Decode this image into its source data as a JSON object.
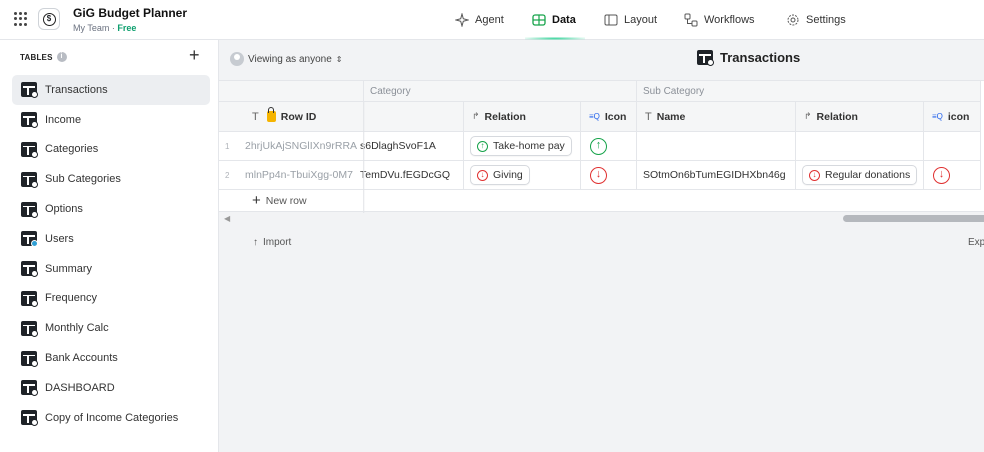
{
  "app": {
    "title": "GiG Budget Planner",
    "team": "My Team",
    "separator": " · ",
    "plan": "Free"
  },
  "nav": [
    {
      "label": "Agent",
      "icon": "sparkle-icon"
    },
    {
      "label": "Data",
      "icon": "table-icon",
      "active": true
    },
    {
      "label": "Layout",
      "icon": "layout-icon"
    },
    {
      "label": "Workflows",
      "icon": "workflow-icon"
    },
    {
      "label": "Settings",
      "icon": "gear-icon"
    }
  ],
  "sidebar": {
    "heading": "TABLES",
    "info": "i",
    "add": "+",
    "items": [
      {
        "label": "Transactions",
        "selected": true
      },
      {
        "label": "Income"
      },
      {
        "label": "Categories"
      },
      {
        "label": "Sub Categories"
      },
      {
        "label": "Options"
      },
      {
        "label": "Users"
      },
      {
        "label": "Summary"
      },
      {
        "label": "Frequency"
      },
      {
        "label": "Monthly Calc"
      },
      {
        "label": "Bank Accounts"
      },
      {
        "label": "DASHBOARD"
      },
      {
        "label": "Copy of Income Categories"
      }
    ]
  },
  "toolbar": {
    "viewing": "Viewing as anyone",
    "table_title": "Transactions"
  },
  "grid": {
    "groups": {
      "category": "Category",
      "sub_category": "Sub Category"
    },
    "headers": {
      "row_id": "Row ID",
      "relation1": "Relation",
      "icon1": "Icon",
      "name": "Name",
      "relation2": "Relation",
      "icon2": "icon"
    },
    "rows": [
      {
        "num": "1",
        "row_id": "2hrjUkAjSNGlIXn9rRRA",
        "category_id": "s6DlaghSvoF1A",
        "relation": "Take-home pay",
        "relation_dir": "up",
        "icon_dir": "up",
        "name": "",
        "sub_relation": "",
        "sub_icon": ""
      },
      {
        "num": "2",
        "row_id": "mlnPp4n-TbuiXgg-0M7",
        "category_id": "TemDVu.fEGDcGQ",
        "relation": "Giving",
        "relation_dir": "down",
        "icon_dir": "down",
        "name": "SOtmOn6bTumEGIDHXbn46g",
        "sub_relation": "Regular donations",
        "sub_icon": "down"
      }
    ],
    "new_row": "New row",
    "text_type": "T",
    "relation_type": "↱",
    "icon_type": "≡Q"
  },
  "footer": {
    "import": "Import",
    "export": "Exp"
  },
  "colors": {
    "up_green": "#16a34a",
    "down_red": "#e03131",
    "plan_green": "#0e9f6e",
    "lock_yellow": "#f5b400"
  }
}
